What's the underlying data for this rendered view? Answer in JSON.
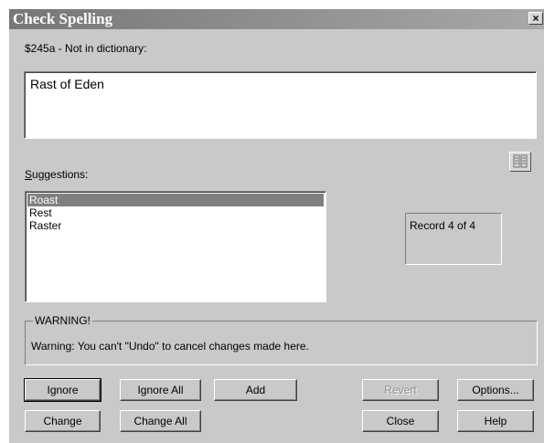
{
  "window": {
    "title": "Check Spelling",
    "close_glyph": "×"
  },
  "field_status": "$245a - Not in dictionary:",
  "current_text": "Rast of Eden",
  "suggestions": {
    "label": "Suggestions:",
    "items": [
      "Roast",
      "Rest",
      "Raster"
    ],
    "selected": "Roast"
  },
  "record_status": "Record 4 of 4",
  "dictionary_icon": "dictionary-icon",
  "warning": {
    "legend": "WARNING!",
    "message": "Warning: You can't \"Undo\" to cancel changes made here."
  },
  "buttons": {
    "ignore": "Ignore",
    "ignore_all": "Ignore All",
    "add": "Add",
    "revert": "Revert",
    "options": "Options...",
    "change": "Change",
    "change_all": "Change All",
    "close": "Close",
    "help": "Help"
  },
  "colors": {
    "dialog_bg": "#c9c9c9",
    "titlebar": "#777777",
    "selection": "#808080"
  }
}
